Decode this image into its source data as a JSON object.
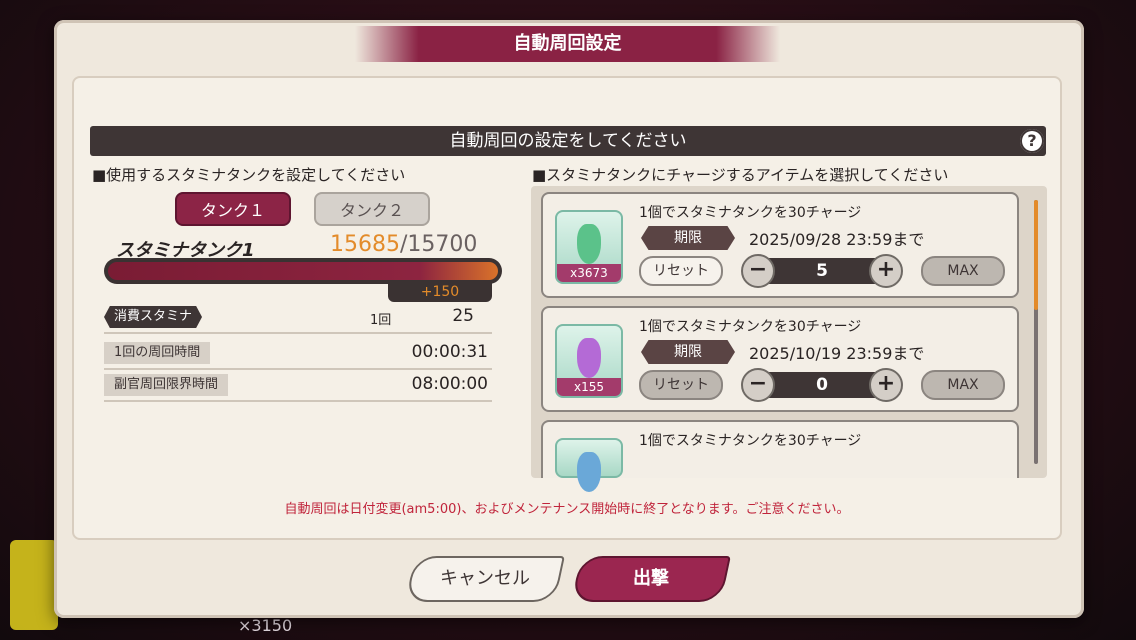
{
  "background": {
    "bottom_counter": "×3150"
  },
  "dialog": {
    "title": "自動周回設定",
    "header": "自動周回の設定をしてください",
    "help_label": "?"
  },
  "left": {
    "section_label": "■使用するスタミナタンクを設定してください",
    "tabs": [
      {
        "label": "タンク１",
        "active": true
      },
      {
        "label": "タンク２",
        "active": false
      }
    ],
    "tank": {
      "name": "スタミナタンク1",
      "current": "15685",
      "max": "/15700",
      "fill_fraction": 0.999,
      "plus": "+150"
    },
    "rows": [
      {
        "label": "消費スタミナ",
        "unit": "1回",
        "value": "25"
      },
      {
        "label": "1回の周回時間",
        "unit": "",
        "value": "00:00:31"
      },
      {
        "label": "副官周回限界時間",
        "unit": "",
        "value": "08:00:00"
      }
    ]
  },
  "right": {
    "section_label": "■スタミナタンクにチャージするアイテムを選択してください",
    "items": [
      {
        "qty": "x3673",
        "desc": "1個でスタミナタンクを30チャージ",
        "deadline_label": "期限",
        "deadline": "2025/09/28 23:59まで",
        "reset": "リセット",
        "minus": "−",
        "plus": "+",
        "count": "5",
        "max": "MAX",
        "gem_color": "#5bc28a"
      },
      {
        "qty": "x155",
        "desc": "1個でスタミナタンクを30チャージ",
        "deadline_label": "期限",
        "deadline": "2025/10/19 23:59まで",
        "reset": "リセット",
        "minus": "−",
        "plus": "+",
        "count": "0",
        "max": "MAX",
        "gem_color": "#b46ad6"
      },
      {
        "qty": "",
        "desc": "1個でスタミナタンクを30チャージ",
        "gem_color": "#6aa8d8"
      }
    ]
  },
  "notice": "自動周回は日付変更(am5:00)、およびメンテナンス開始時に終了となります。ご注意ください。",
  "buttons": {
    "cancel": "キャンセル",
    "go": "出撃"
  }
}
